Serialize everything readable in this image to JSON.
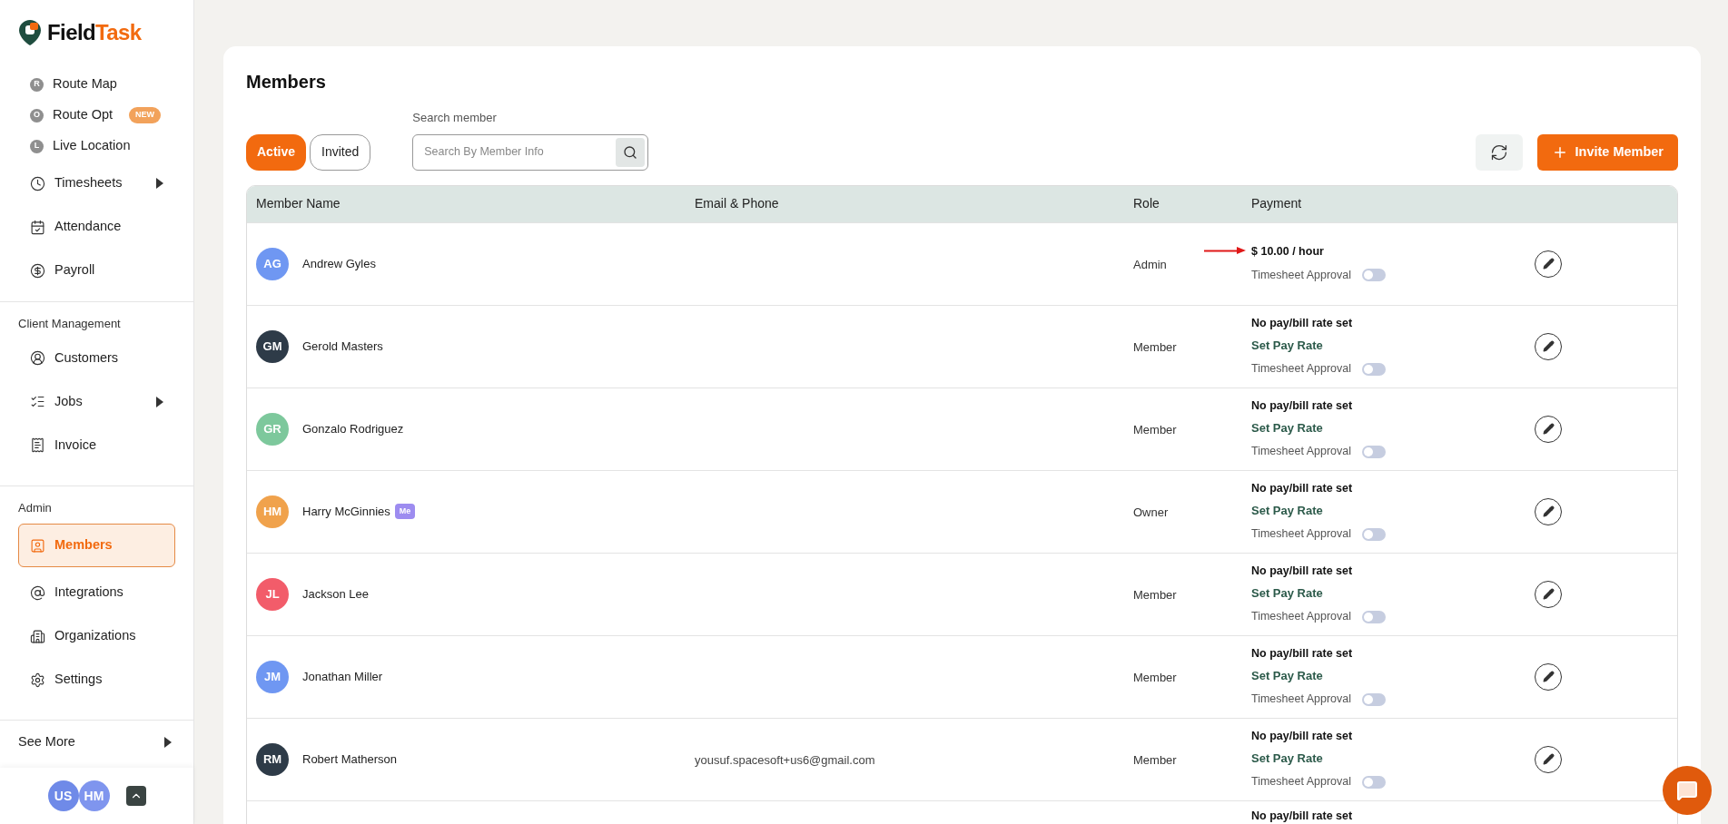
{
  "brand": {
    "name_first": "Field",
    "name_second": "Task"
  },
  "sidebar": {
    "sections": [
      {
        "items": [
          {
            "label": "Route Map",
            "kind": "letter",
            "letter": "R",
            "selected": false,
            "expandable": false
          },
          {
            "label": "Route Opt",
            "kind": "letter",
            "letter": "O",
            "selected": false,
            "expandable": false,
            "badge": "NEW"
          },
          {
            "label": "Live Location",
            "kind": "letter",
            "letter": "L",
            "selected": false,
            "expandable": false
          },
          {
            "label": "Timesheets",
            "kind": "clock",
            "selected": false,
            "expandable": true
          },
          {
            "label": "Attendance",
            "kind": "calendar",
            "selected": false,
            "expandable": false
          },
          {
            "label": "Payroll",
            "kind": "dollar",
            "selected": false,
            "expandable": false
          }
        ]
      },
      {
        "label": "Client Management",
        "items": [
          {
            "label": "Customers",
            "kind": "user",
            "selected": false,
            "expandable": false
          },
          {
            "label": "Jobs",
            "kind": "list",
            "selected": false,
            "expandable": true
          },
          {
            "label": "Invoice",
            "kind": "receipt",
            "selected": false,
            "expandable": false
          }
        ]
      },
      {
        "label": "Admin",
        "items": [
          {
            "label": "Members",
            "kind": "member",
            "selected": true,
            "expandable": false
          },
          {
            "label": "Integrations",
            "kind": "at",
            "selected": false,
            "expandable": false
          },
          {
            "label": "Organizations",
            "kind": "building",
            "selected": false,
            "expandable": false
          },
          {
            "label": "Settings",
            "kind": "gear",
            "selected": false,
            "expandable": false
          }
        ]
      }
    ],
    "see_more": "See More",
    "users": [
      {
        "initials": "US",
        "color": "#6f8ae8"
      },
      {
        "initials": "HM",
        "color": "#7f95ee"
      }
    ]
  },
  "page": {
    "title": "Members",
    "tabs": [
      {
        "label": "Active",
        "selected": true
      },
      {
        "label": "Invited",
        "selected": false
      }
    ],
    "search": {
      "label": "Search member",
      "placeholder": "Search By Member Info"
    },
    "invite_button": "Invite Member"
  },
  "table": {
    "columns": [
      "Member Name",
      "Email & Phone",
      "Role",
      "Payment"
    ],
    "rows": [
      {
        "initials": "AG",
        "color": "#6f97f2",
        "name": "Andrew Gyles",
        "email": "",
        "role": "Admin",
        "rate": "$ 10.00 / hour",
        "annotated": true,
        "toggle_label": "Timesheet Approval",
        "on": false
      },
      {
        "initials": "GM",
        "color": "#2e3b48",
        "name": "Gerold Masters",
        "email": "",
        "role": "Member",
        "rate": "No pay/bill rate set",
        "set_rate": "Set Pay Rate",
        "toggle_label": "Timesheet Approval",
        "on": false
      },
      {
        "initials": "GR",
        "color": "#7dc89c",
        "name": "Gonzalo Rodriguez",
        "email": "",
        "role": "Member",
        "rate": "No pay/bill rate set",
        "set_rate": "Set Pay Rate",
        "toggle_label": "Timesheet Approval",
        "on": false
      },
      {
        "initials": "HM",
        "color": "#f0a24c",
        "name": "Harry McGinnies",
        "badge": "Me",
        "email": "",
        "role": "Owner",
        "rate": "No pay/bill rate set",
        "set_rate": "Set Pay Rate",
        "toggle_label": "Timesheet Approval",
        "on": false
      },
      {
        "initials": "JL",
        "color": "#f25c6a",
        "name": "Jackson Lee",
        "email": "",
        "role": "Member",
        "rate": "No pay/bill rate set",
        "set_rate": "Set Pay Rate",
        "toggle_label": "Timesheet Approval",
        "on": false
      },
      {
        "initials": "JM",
        "color": "#6f97f2",
        "name": "Jonathan Miller",
        "email": "",
        "role": "Member",
        "rate": "No pay/bill rate set",
        "set_rate": "Set Pay Rate",
        "toggle_label": "Timesheet Approval",
        "on": false
      },
      {
        "initials": "RM",
        "color": "#2e3b48",
        "name": "Robert Matherson",
        "email": "yousuf.spacesoft+us6@gmail.com",
        "role": "Member",
        "rate": "No pay/bill rate set",
        "set_rate": "Set Pay Rate",
        "toggle_label": "Timesheet Approval",
        "on": false
      },
      {
        "kind": "partial",
        "rate": "No pay/bill rate set"
      }
    ]
  }
}
